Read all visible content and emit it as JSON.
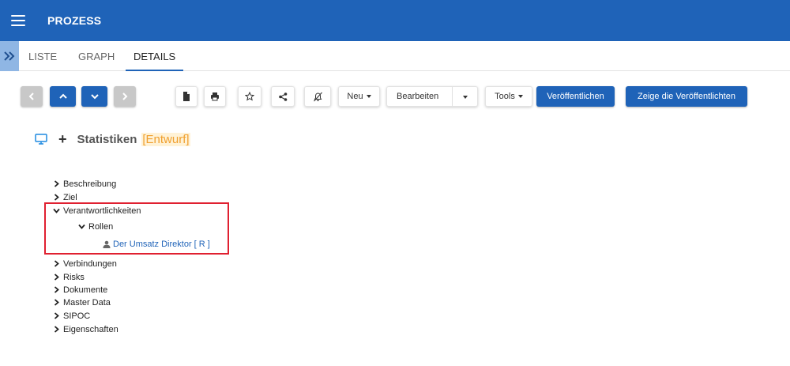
{
  "app": {
    "title": "PROZESS"
  },
  "tabs": [
    {
      "label": "LISTE"
    },
    {
      "label": "GRAPH"
    },
    {
      "label": "DETAILS"
    }
  ],
  "toolbar": {
    "new_label": "Neu",
    "edit_label": "Bearbeiten",
    "tools_label": "Tools",
    "publish_label": "Veröffentlichen",
    "show_published_label": "Zeige die Veröffentlichten"
  },
  "header": {
    "title": "Statistiken",
    "status": "[Entwurf]"
  },
  "tree": {
    "beschreibung": "Beschreibung",
    "ziel": "Ziel",
    "verantwortlichkeiten": "Verantwortlichkeiten",
    "rollen": "Rollen",
    "role": "Der Umsatz Direktor [ R ]",
    "verbindungen": "Verbindungen",
    "risks": "Risks",
    "dokumente": "Dokumente",
    "master_data": "Master Data",
    "sipoc": "SIPOC",
    "eigenschaften": "Eigenschaften"
  },
  "colors": {
    "primary": "#1f63b8",
    "draft": "#f0a030",
    "highlight": "#e02030"
  }
}
